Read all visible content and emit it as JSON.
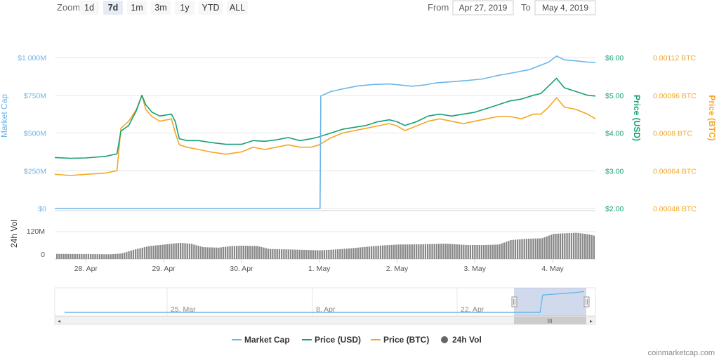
{
  "toolbar": {
    "zoom_label": "Zoom",
    "buttons": [
      "1d",
      "7d",
      "1m",
      "3m",
      "1y",
      "YTD",
      "ALL"
    ],
    "active_button": "7d",
    "from_label": "From",
    "from_value": "Apr 27, 2019",
    "to_label": "To",
    "to_value": "May 4, 2019"
  },
  "credit": "coinmarketcap.com",
  "colors": {
    "market_cap": "#6cb6e8",
    "price_usd": "#16a077",
    "price_btc": "#f5a623",
    "volume": "#888888"
  },
  "chart_data": {
    "type": "line",
    "x_tick_labels": [
      "28. Apr",
      "29. Apr",
      "30. Apr",
      "1. May",
      "2. May",
      "3. May",
      "4. May"
    ],
    "x_range_days": [
      27.6,
      34.55
    ],
    "axes": {
      "market_cap": {
        "title": "Market Cap",
        "ticks": [
          "$0",
          "$250M",
          "$500M",
          "$750M",
          "$1 000M"
        ],
        "range": [
          0,
          1000
        ]
      },
      "price_usd": {
        "title": "Price (USD)",
        "ticks": [
          "$2.00",
          "$3.00",
          "$4.00",
          "$5.00",
          "$6.00"
        ],
        "range": [
          2,
          6
        ]
      },
      "price_btc": {
        "title": "Price (BTC)",
        "ticks": [
          "0.00048 BTC",
          "0.00064 BTC",
          "0.0008 BTC",
          "0.00096 BTC",
          "0.00112 BTC"
        ],
        "range": [
          0.00048,
          0.00112
        ]
      },
      "volume": {
        "title": "24h Vol",
        "ticks": [
          "0",
          "120M"
        ],
        "range": [
          0,
          120
        ]
      }
    },
    "series": [
      {
        "name": "Market Cap",
        "unit": "M USD",
        "points": [
          [
            27.6,
            0
          ],
          [
            29.0,
            0
          ],
          [
            30.0,
            0
          ],
          [
            31.0,
            0
          ],
          [
            31.01,
            0
          ],
          [
            31.02,
            745
          ],
          [
            31.05,
            752
          ],
          [
            31.15,
            775
          ],
          [
            31.3,
            792
          ],
          [
            31.5,
            812
          ],
          [
            31.7,
            822
          ],
          [
            31.9,
            825
          ],
          [
            32.0,
            820
          ],
          [
            32.1,
            815
          ],
          [
            32.2,
            810
          ],
          [
            32.35,
            818
          ],
          [
            32.5,
            832
          ],
          [
            32.7,
            840
          ],
          [
            32.9,
            848
          ],
          [
            33.1,
            858
          ],
          [
            33.3,
            882
          ],
          [
            33.5,
            900
          ],
          [
            33.7,
            920
          ],
          [
            33.8,
            940
          ],
          [
            33.95,
            970
          ],
          [
            34.05,
            1010
          ],
          [
            34.15,
            985
          ],
          [
            34.3,
            978
          ],
          [
            34.45,
            970
          ],
          [
            34.55,
            968
          ]
        ]
      },
      {
        "name": "Price (USD)",
        "unit": "USD",
        "points": [
          [
            27.6,
            3.35
          ],
          [
            27.8,
            3.33
          ],
          [
            28.0,
            3.34
          ],
          [
            28.25,
            3.38
          ],
          [
            28.4,
            3.45
          ],
          [
            28.45,
            4.05
          ],
          [
            28.55,
            4.2
          ],
          [
            28.65,
            4.6
          ],
          [
            28.72,
            5.0
          ],
          [
            28.77,
            4.75
          ],
          [
            28.85,
            4.55
          ],
          [
            28.95,
            4.45
          ],
          [
            29.1,
            4.5
          ],
          [
            29.15,
            4.3
          ],
          [
            29.2,
            3.85
          ],
          [
            29.3,
            3.8
          ],
          [
            29.45,
            3.8
          ],
          [
            29.6,
            3.75
          ],
          [
            29.8,
            3.7
          ],
          [
            30.0,
            3.7
          ],
          [
            30.15,
            3.8
          ],
          [
            30.3,
            3.78
          ],
          [
            30.45,
            3.82
          ],
          [
            30.6,
            3.88
          ],
          [
            30.75,
            3.8
          ],
          [
            30.9,
            3.85
          ],
          [
            31.0,
            3.9
          ],
          [
            31.15,
            4.0
          ],
          [
            31.3,
            4.1
          ],
          [
            31.45,
            4.15
          ],
          [
            31.6,
            4.2
          ],
          [
            31.75,
            4.3
          ],
          [
            31.9,
            4.35
          ],
          [
            32.0,
            4.3
          ],
          [
            32.1,
            4.2
          ],
          [
            32.25,
            4.3
          ],
          [
            32.4,
            4.45
          ],
          [
            32.55,
            4.5
          ],
          [
            32.7,
            4.45
          ],
          [
            32.85,
            4.5
          ],
          [
            33.0,
            4.55
          ],
          [
            33.15,
            4.65
          ],
          [
            33.3,
            4.75
          ],
          [
            33.45,
            4.85
          ],
          [
            33.6,
            4.9
          ],
          [
            33.75,
            5.0
          ],
          [
            33.85,
            5.05
          ],
          [
            33.95,
            5.25
          ],
          [
            34.05,
            5.45
          ],
          [
            34.15,
            5.2
          ],
          [
            34.3,
            5.1
          ],
          [
            34.45,
            5.0
          ],
          [
            34.55,
            4.98
          ]
        ]
      },
      {
        "name": "Price (BTC)",
        "unit": "BTC",
        "points": [
          [
            27.6,
            0.000625
          ],
          [
            27.8,
            0.00062
          ],
          [
            28.0,
            0.000625
          ],
          [
            28.25,
            0.00063
          ],
          [
            28.4,
            0.00064
          ],
          [
            28.45,
            0.00082
          ],
          [
            28.55,
            0.00085
          ],
          [
            28.65,
            0.0009
          ],
          [
            28.72,
            0.00096
          ],
          [
            28.77,
            0.0009
          ],
          [
            28.85,
            0.00087
          ],
          [
            28.95,
            0.00085
          ],
          [
            29.1,
            0.00086
          ],
          [
            29.15,
            0.0008
          ],
          [
            29.2,
            0.00075
          ],
          [
            29.3,
            0.00074
          ],
          [
            29.45,
            0.00073
          ],
          [
            29.6,
            0.00072
          ],
          [
            29.8,
            0.00071
          ],
          [
            30.0,
            0.00072
          ],
          [
            30.15,
            0.00074
          ],
          [
            30.3,
            0.00073
          ],
          [
            30.45,
            0.00074
          ],
          [
            30.6,
            0.00075
          ],
          [
            30.75,
            0.00074
          ],
          [
            30.9,
            0.00074
          ],
          [
            31.0,
            0.00075
          ],
          [
            31.15,
            0.00078
          ],
          [
            31.3,
            0.0008
          ],
          [
            31.45,
            0.00081
          ],
          [
            31.6,
            0.00082
          ],
          [
            31.75,
            0.00083
          ],
          [
            31.9,
            0.00084
          ],
          [
            32.0,
            0.00083
          ],
          [
            32.1,
            0.00081
          ],
          [
            32.25,
            0.00083
          ],
          [
            32.4,
            0.00085
          ],
          [
            32.55,
            0.00086
          ],
          [
            32.7,
            0.00085
          ],
          [
            32.85,
            0.00084
          ],
          [
            33.0,
            0.00085
          ],
          [
            33.15,
            0.00086
          ],
          [
            33.3,
            0.00087
          ],
          [
            33.45,
            0.00087
          ],
          [
            33.6,
            0.00086
          ],
          [
            33.75,
            0.00088
          ],
          [
            33.85,
            0.00088
          ],
          [
            33.95,
            0.00091
          ],
          [
            34.05,
            0.00095
          ],
          [
            34.15,
            0.00091
          ],
          [
            34.3,
            0.0009
          ],
          [
            34.45,
            0.00088
          ],
          [
            34.55,
            0.00086
          ]
        ]
      },
      {
        "name": "24h Vol",
        "unit": "M USD",
        "type": "column",
        "points": [
          [
            27.6,
            20
          ],
          [
            28.0,
            19
          ],
          [
            28.3,
            18
          ],
          [
            28.45,
            22
          ],
          [
            28.6,
            38
          ],
          [
            28.8,
            55
          ],
          [
            29.0,
            62
          ],
          [
            29.2,
            70
          ],
          [
            29.35,
            65
          ],
          [
            29.5,
            50
          ],
          [
            29.7,
            48
          ],
          [
            29.85,
            55
          ],
          [
            30.0,
            57
          ],
          [
            30.2,
            55
          ],
          [
            30.35,
            42
          ],
          [
            30.6,
            40
          ],
          [
            30.8,
            38
          ],
          [
            31.0,
            36
          ],
          [
            31.2,
            40
          ],
          [
            31.4,
            45
          ],
          [
            31.6,
            52
          ],
          [
            31.8,
            58
          ],
          [
            32.0,
            62
          ],
          [
            32.3,
            63
          ],
          [
            32.6,
            66
          ],
          [
            32.9,
            60
          ],
          [
            33.1,
            60
          ],
          [
            33.3,
            62
          ],
          [
            33.45,
            82
          ],
          [
            33.65,
            88
          ],
          [
            33.85,
            90
          ],
          [
            34.0,
            110
          ],
          [
            34.1,
            112
          ],
          [
            34.3,
            115
          ],
          [
            34.45,
            108
          ],
          [
            34.55,
            100
          ]
        ]
      }
    ],
    "navigator": {
      "x_tick_labels": [
        "25. Mar",
        "8. Apr",
        "22. Apr"
      ],
      "series": "Market Cap",
      "points": [
        [
          0,
          0
        ],
        [
          0.915,
          0
        ],
        [
          0.92,
          0.75
        ],
        [
          0.95,
          0.8
        ],
        [
          0.98,
          0.85
        ],
        [
          1.0,
          0.9
        ]
      ]
    },
    "legend": [
      "Market Cap",
      "Price (USD)",
      "Price (BTC)",
      "24h Vol"
    ],
    "legend_position": "bottom-center"
  }
}
